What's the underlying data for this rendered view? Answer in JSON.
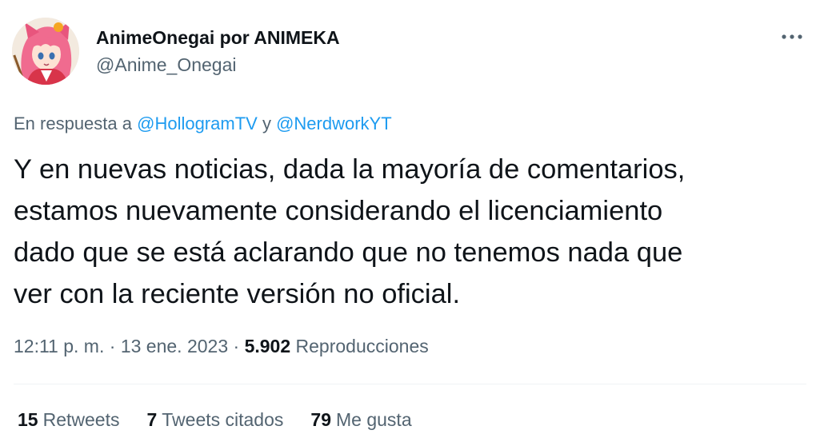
{
  "author": {
    "display_name": "AnimeOnegai por ANIMEKA",
    "handle": "@Anime_Onegai",
    "avatar_icon": "anime-girl-avatar"
  },
  "reply_to": {
    "prefix": "En respuesta a",
    "mention_1": "@HollogramTV",
    "conjunction": "y",
    "mention_2": "@NerdworkYT"
  },
  "tweet": {
    "text": "Y en nuevas noticias, dada la mayoría de comentarios,\nestamos nuevamente considerando el licenciamiento\ndado que se está aclarando que no tenemos nada que\nver con la reciente versión no oficial."
  },
  "meta": {
    "time": "12:11 p. m.",
    "separator": "·",
    "date": "13 ene. 2023",
    "views_count": "5.902",
    "views_label": "Reproducciones"
  },
  "stats": {
    "retweets_count": "15",
    "retweets_label": "Retweets",
    "quotes_count": "7",
    "quotes_label": "Tweets citados",
    "likes_count": "79",
    "likes_label": "Me gusta"
  },
  "colors": {
    "link": "#1d9bf0",
    "secondary_text": "#536471",
    "primary_text": "#0f1419",
    "divider": "#eff3f4"
  },
  "icons": {
    "more": "more-horizontal-icon"
  }
}
